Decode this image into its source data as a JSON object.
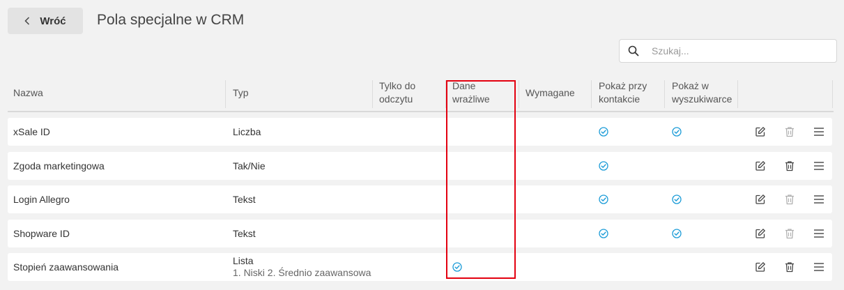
{
  "header": {
    "back_label": "Wróć",
    "title": "Pola specjalne w CRM"
  },
  "search": {
    "placeholder": "Szukaj..."
  },
  "columns": {
    "name": "Nazwa",
    "type": "Typ",
    "readonly_line1": "Tylko do",
    "readonly_line2": "odczytu",
    "sensitive_line1": "Dane",
    "sensitive_line2": "wrażliwe",
    "required": "Wymagane",
    "show_contact_line1": "Pokaż przy",
    "show_contact_line2": "kontakcie",
    "show_search_line1": "Pokaż w",
    "show_search_line2": "wyszukiwarce"
  },
  "rows": [
    {
      "name": "xSale ID",
      "type": "Liczba",
      "type_sub": "",
      "readonly": false,
      "sensitive": false,
      "required": false,
      "show_contact": true,
      "show_search": true,
      "delete_enabled": false
    },
    {
      "name": "Zgoda marketingowa",
      "type": "Tak/Nie",
      "type_sub": "",
      "readonly": false,
      "sensitive": false,
      "required": false,
      "show_contact": true,
      "show_search": false,
      "delete_enabled": true
    },
    {
      "name": "Login Allegro",
      "type": "Tekst",
      "type_sub": "",
      "readonly": false,
      "sensitive": false,
      "required": false,
      "show_contact": true,
      "show_search": true,
      "delete_enabled": false
    },
    {
      "name": "Shopware ID",
      "type": "Tekst",
      "type_sub": "",
      "readonly": false,
      "sensitive": false,
      "required": false,
      "show_contact": true,
      "show_search": true,
      "delete_enabled": false
    },
    {
      "name": "Stopień zaawansowania",
      "type": "Lista",
      "type_sub": "1. Niski 2. Średnio zaawansowa",
      "readonly": false,
      "sensitive": true,
      "required": false,
      "show_contact": false,
      "show_search": false,
      "delete_enabled": true
    }
  ],
  "colors": {
    "check": "#1a9bd7",
    "highlight": "#e3000f",
    "icon": "#444444",
    "icon_disabled": "#b0b0b0"
  },
  "icons": {
    "back": "chevron-left-icon",
    "search": "search-icon",
    "check": "check-circle-icon",
    "edit": "edit-icon",
    "delete": "trash-icon",
    "menu": "menu-icon"
  }
}
